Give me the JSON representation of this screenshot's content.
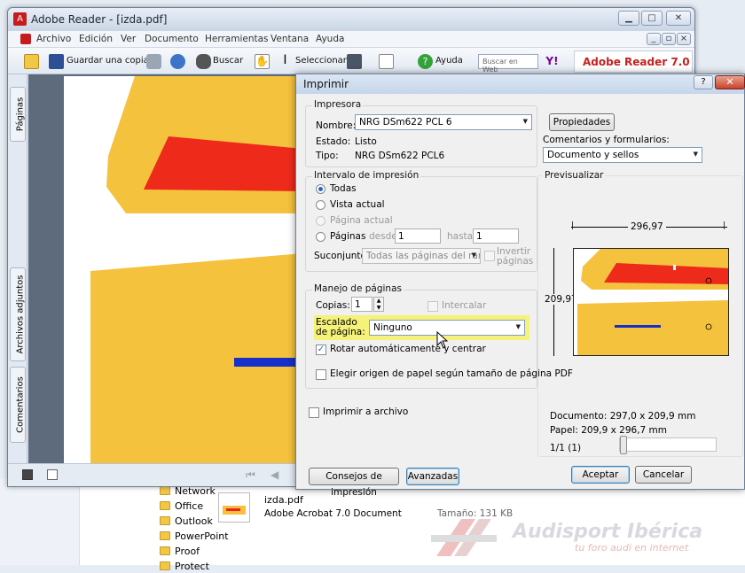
{
  "reader": {
    "title": "Adobe Reader - [izda.pdf]",
    "menu": [
      "Archivo",
      "Edición",
      "Ver",
      "Documento",
      "Herramientas",
      "Ventana",
      "Ayuda"
    ],
    "toolbar": {
      "save_copy": "Guardar una copia",
      "search": "Buscar",
      "select": "Seleccionar",
      "help": "Ayuda",
      "search_web_placeholder": "Buscar en Web",
      "brand": "Adobe Reader 7.0"
    },
    "nav_tabs": [
      "Páginas",
      "Archivos adjuntos",
      "Comentarios"
    ]
  },
  "print_dialog": {
    "title": "Imprimir",
    "printer": {
      "group_label": "Impresora",
      "name_label": "Nombre:",
      "name_value": "NRG DSm622 PCL 6",
      "properties_button": "Propiedades",
      "status_label": "Estado:",
      "status_value": "Listo",
      "type_label": "Tipo:",
      "type_value": "NRG DSm622 PCL6",
      "comments_label": "Comentarios y formularios:",
      "comments_value": "Documento y sellos"
    },
    "range": {
      "group_label": "Intervalo de impresión",
      "all": "Todas",
      "current_view": "Vista actual",
      "current_page": "Página actual",
      "pages": "Páginas",
      "from_label": "desde:",
      "from_value": "1",
      "to_label": "hasta:",
      "to_value": "1",
      "subset_label": "Suconjunto:",
      "subset_value": "Todas las páginas del rango",
      "invert_label": "Invertir páginas"
    },
    "handling": {
      "group_label": "Manejo de páginas",
      "copies_label": "Copias:",
      "copies_value": "1",
      "collate_label": "Intercalar",
      "scaling_label": "Escalado de página:",
      "scaling_value": "Ninguno",
      "auto_rotate_label": "Rotar automáticamente y centrar",
      "paper_source_label": "Elegir origen de papel según tamaño de página PDF"
    },
    "print_to_file": "Imprimir a archivo",
    "preview": {
      "group_label": "Previsualizar",
      "width": "296,97",
      "height": "209,97",
      "document_size": "Documento: 297,0 x 209,9 mm",
      "paper_size": "Papel: 209,9 x 296,7 mm",
      "page_indicator": "1/1 (1)"
    },
    "buttons": {
      "tips": "Consejos de impresión",
      "advanced": "Avanzadas",
      "accept": "Aceptar",
      "cancel": "Cancelar"
    }
  },
  "explorer": {
    "folders": [
      "Network",
      "Office",
      "Outlook",
      "PowerPoint",
      "Proof",
      "Protect"
    ],
    "file_name": "izda.pdf",
    "file_type": "Adobe Acrobat 7.0 Document",
    "file_size": "Tamaño: 131 KB"
  },
  "watermark": {
    "brand": "Audisport Ibérica",
    "tagline": "tu foro audi en internet"
  },
  "colors": {
    "yellow": "#f5c23d",
    "red": "#ee2a1b",
    "blue": "#1630c8",
    "highlight": "#f5f27a"
  }
}
